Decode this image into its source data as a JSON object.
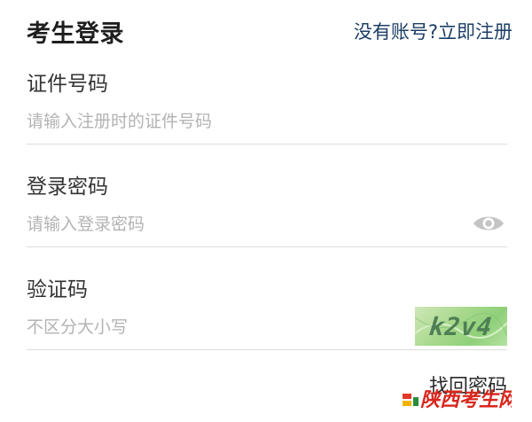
{
  "header": {
    "title": "考生登录",
    "register_link": "没有账号?立即注册"
  },
  "form": {
    "id_number": {
      "label": "证件号码",
      "placeholder": "请输入注册时的证件号码",
      "value": ""
    },
    "password": {
      "label": "登录密码",
      "placeholder": "请输入登录密码",
      "value": "",
      "toggle_icon": "eye-icon"
    },
    "captcha": {
      "label": "验证码",
      "placeholder": "不区分大小写",
      "value": "",
      "image_text": "k2v4"
    }
  },
  "forgot_password": "找回密码",
  "watermark_text": "陕西考生网",
  "colors": {
    "link": "#1d3f66",
    "divider": "#dcdcdc",
    "placeholder": "#b3b3b3",
    "captcha_bg": "#a9d98d",
    "watermark_red": "#d9261c"
  }
}
